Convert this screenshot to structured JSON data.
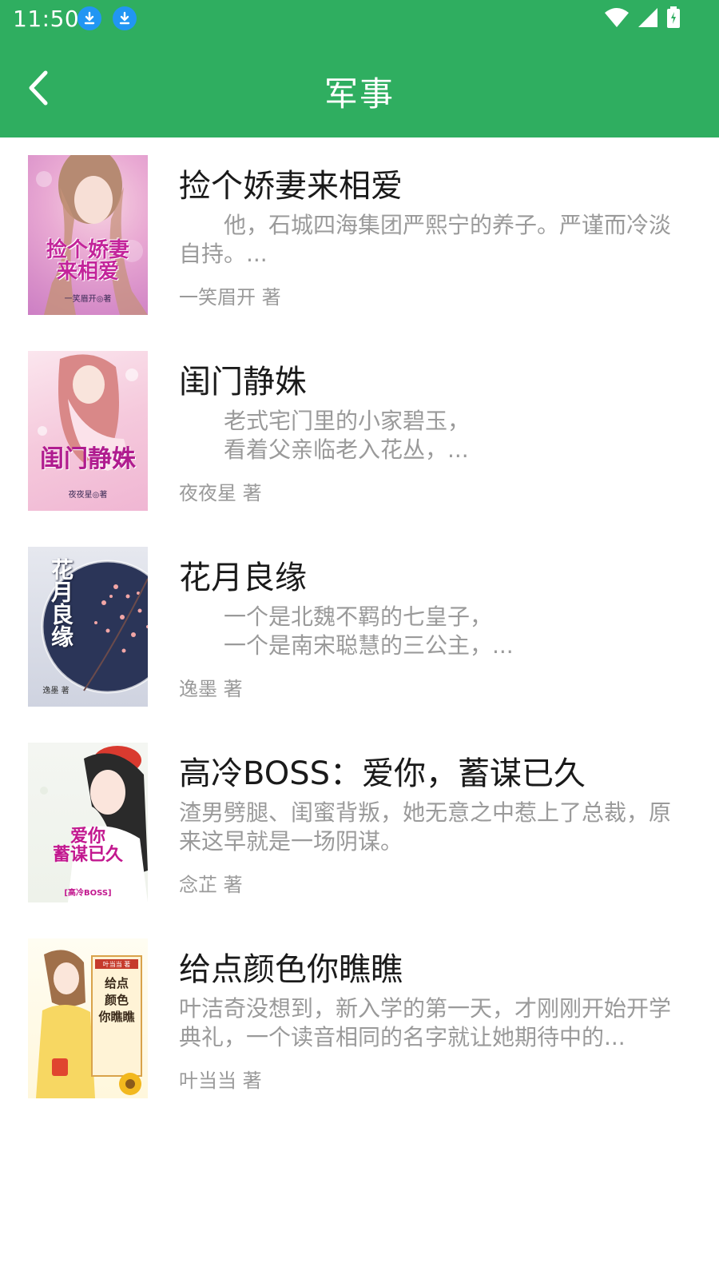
{
  "status_bar": {
    "time": "11:50",
    "icons": [
      "download-icon",
      "download-icon",
      "wifi-icon",
      "signal-icon",
      "battery-icon"
    ]
  },
  "header": {
    "title": "军事",
    "back_icon": "chevron-left-icon"
  },
  "colors": {
    "primary": "#2fae60",
    "title_text": "#1a1a1a",
    "secondary_text": "#9a9a9a"
  },
  "books": [
    {
      "title": "捡个娇妻来相爱",
      "desc": "　　他，石城四海集团严熙宁的养子。严谨而冷淡自持。...",
      "author": "一笑眉开 著",
      "cover_title": "捡个娇妻\n来相爱",
      "cover_author": "一笑眉开◎著"
    },
    {
      "title": "闺门静姝",
      "desc": "　　老式宅门里的小家碧玉，\n　　看着父亲临老入花丛，...",
      "author": "夜夜星 著",
      "cover_title": "闺门静姝",
      "cover_author": "夜夜星◎著"
    },
    {
      "title": "花月良缘",
      "desc": "　　一个是北魏不羁的七皇子，\n　　一个是南宋聪慧的三公主，...",
      "author": "逸墨 著",
      "cover_title": "花月良缘",
      "cover_author": "逸墨 著"
    },
    {
      "title": "高冷BOSS：爱你，蓄谋已久",
      "desc": "渣男劈腿、闺蜜背叛，她无意之中惹上了总裁，原来这早就是一场阴谋。",
      "author": "念芷 著",
      "cover_title": "爱你\n蓄谋已久",
      "cover_author": "[高冷BOSS]"
    },
    {
      "title": "给点颜色你瞧瞧",
      "desc": "叶洁奇没想到，新入学的第一天，才刚刚开始开学典礼，一个读音相同的名字就让她期待中的...",
      "author": "叶当当 著",
      "cover_title": "给点\n颜色\n你瞧瞧",
      "cover_author": "叶当当 著"
    }
  ]
}
